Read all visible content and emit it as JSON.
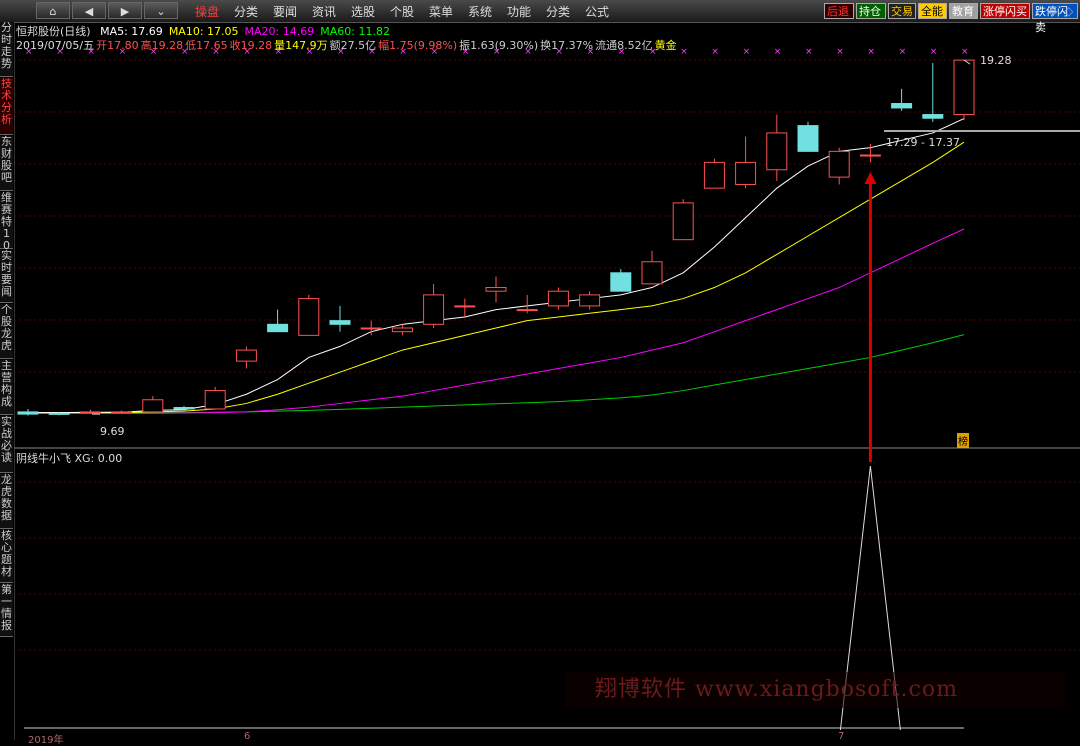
{
  "topbar": {
    "nav": [
      {
        "name": "home-icon",
        "glyph": "⌂"
      },
      {
        "name": "back-icon",
        "glyph": "◀"
      },
      {
        "name": "forward-icon",
        "glyph": "▶"
      },
      {
        "name": "expand-icon",
        "glyph": "⌄"
      }
    ],
    "menu": [
      "操盘",
      "分类",
      "要闻",
      "资讯",
      "选股",
      "个股",
      "菜单",
      "系统",
      "功能",
      "分类",
      "公式"
    ],
    "active_menu": "操盘",
    "tags": [
      {
        "label": "后退",
        "color": "#ff3030",
        "bg": "#300000"
      },
      {
        "label": "持仓",
        "color": "#ffffff",
        "bg": "#006000"
      },
      {
        "label": "交易",
        "color": "#ffcc00",
        "bg": "#202020"
      },
      {
        "label": "全能",
        "color": "#000000",
        "bg": "#ffcc00"
      },
      {
        "label": "教育",
        "color": "#ffffff",
        "bg": "#a0a0a0"
      },
      {
        "label": "涨停闪买",
        "color": "#ffffff",
        "bg": "#c00000"
      },
      {
        "label": "跌停闪卖",
        "color": "#ffffff",
        "bg": "#0050c0"
      }
    ],
    "window_controls": [
      "◇",
      "◇"
    ]
  },
  "left_tabs": [
    {
      "label": "分时走势",
      "active": false
    },
    {
      "label": "技术分析",
      "active": true
    },
    {
      "label": "东财股吧",
      "active": false
    },
    {
      "label": "维赛特10",
      "active": false
    },
    {
      "label": "实时要闻",
      "active": false
    },
    {
      "label": "个股龙虎",
      "active": false
    },
    {
      "label": "主营构成",
      "active": false
    },
    {
      "label": "实战必读",
      "active": false
    },
    {
      "label": "龙虎数据",
      "active": false
    },
    {
      "label": "核心题材",
      "active": false
    },
    {
      "label": "第一情报",
      "active": false
    }
  ],
  "header": {
    "stock": "恒邦股份(日线)",
    "ma": [
      {
        "label": "MA5: 17.69",
        "color": "#ffffff"
      },
      {
        "label": "MA10: 17.05",
        "color": "#ffff00"
      },
      {
        "label": "MA20: 14.69",
        "color": "#ff00ff"
      },
      {
        "label": "MA60: 11.82",
        "color": "#00ff00"
      }
    ],
    "date": "2019/07/05/五",
    "quote": [
      {
        "label": "开17.80",
        "color": "#ff5050"
      },
      {
        "label": "高19.28",
        "color": "#ff5050"
      },
      {
        "label": "低17.65",
        "color": "#ff5050"
      },
      {
        "label": "收19.28",
        "color": "#ff5050"
      },
      {
        "label": "量147.9万",
        "color": "#ffff00"
      },
      {
        "label": "额27.5亿",
        "color": "#cccccc"
      },
      {
        "label": "幅1.75(9.98%)",
        "color": "#ff5050"
      },
      {
        "label": "振1.63(9.30%)",
        "color": "#cccccc"
      },
      {
        "label": "换17.37%",
        "color": "#cccccc"
      },
      {
        "label": "流通8.52亿",
        "color": "#cccccc"
      },
      {
        "label": "黄金",
        "color": "#ffff00"
      }
    ]
  },
  "indicator_panel": {
    "title": "阴线牛小飞 XG: 0.00"
  },
  "annotations": {
    "high": "19.28",
    "low": "9.69",
    "price_range": "17.29 - 17.37",
    "badge": "榜"
  },
  "xaxis": {
    "left_label": "2019年",
    "mid_label": "6",
    "right_label": "7"
  },
  "watermark": "翔博软件 www.xiangbosoft.com",
  "colors": {
    "up": "#ff5050",
    "down": "#70e0e0",
    "ma5": "#ffffff",
    "ma10": "#ffff00",
    "ma20": "#ff00ff",
    "ma60": "#00cc00",
    "arrow": "#dd0000",
    "grid": "#700000"
  },
  "chart_data": {
    "type": "candlestick",
    "candles": [
      {
        "o": 9.72,
        "h": 9.8,
        "l": 9.62,
        "c": 9.66
      },
      {
        "o": 9.68,
        "h": 9.72,
        "l": 9.63,
        "c": 9.66
      },
      {
        "o": 9.7,
        "h": 9.78,
        "l": 9.68,
        "c": 9.72
      },
      {
        "o": 9.7,
        "h": 9.76,
        "l": 9.68,
        "c": 9.72
      },
      {
        "o": 9.72,
        "h": 10.15,
        "l": 9.7,
        "c": 10.05
      },
      {
        "o": 9.84,
        "h": 9.88,
        "l": 9.74,
        "c": 9.8
      },
      {
        "o": 9.8,
        "h": 10.4,
        "l": 9.78,
        "c": 10.3
      },
      {
        "o": 11.1,
        "h": 11.5,
        "l": 10.9,
        "c": 11.4
      },
      {
        "o": 12.1,
        "h": 12.5,
        "l": 11.9,
        "c": 11.9
      },
      {
        "o": 11.8,
        "h": 12.9,
        "l": 11.8,
        "c": 12.8
      },
      {
        "o": 12.2,
        "h": 12.6,
        "l": 11.9,
        "c": 12.1
      },
      {
        "o": 12.0,
        "h": 12.2,
        "l": 11.8,
        "c": 12.0
      },
      {
        "o": 11.9,
        "h": 12.1,
        "l": 11.8,
        "c": 12.0
      },
      {
        "o": 12.1,
        "h": 13.2,
        "l": 12.0,
        "c": 12.9
      },
      {
        "o": 12.6,
        "h": 12.8,
        "l": 12.3,
        "c": 12.6
      },
      {
        "o": 13.0,
        "h": 13.4,
        "l": 12.7,
        "c": 13.1
      },
      {
        "o": 12.5,
        "h": 12.9,
        "l": 12.4,
        "c": 12.5
      },
      {
        "o": 12.6,
        "h": 13.1,
        "l": 12.5,
        "c": 13.0
      },
      {
        "o": 12.6,
        "h": 13.0,
        "l": 12.5,
        "c": 12.9
      },
      {
        "o": 13.5,
        "h": 13.6,
        "l": 13.0,
        "c": 13.0
      },
      {
        "o": 13.2,
        "h": 14.1,
        "l": 13.2,
        "c": 13.8
      },
      {
        "o": 14.4,
        "h": 15.5,
        "l": 14.4,
        "c": 15.4
      },
      {
        "o": 15.8,
        "h": 16.6,
        "l": 15.8,
        "c": 16.5
      },
      {
        "o": 15.9,
        "h": 17.2,
        "l": 15.8,
        "c": 16.5
      },
      {
        "o": 16.3,
        "h": 17.8,
        "l": 16.0,
        "c": 17.3
      },
      {
        "o": 17.5,
        "h": 17.6,
        "l": 16.8,
        "c": 16.8
      },
      {
        "o": 16.1,
        "h": 16.9,
        "l": 15.9,
        "c": 16.8
      },
      {
        "o": 16.7,
        "h": 17.0,
        "l": 16.5,
        "c": 16.7
      },
      {
        "o": 18.1,
        "h": 18.5,
        "l": 17.9,
        "c": 17.98
      },
      {
        "o": 17.8,
        "h": 19.2,
        "l": 17.6,
        "c": 17.7
      },
      {
        "o": 17.8,
        "h": 19.28,
        "l": 17.65,
        "c": 19.28
      }
    ],
    "ma5": [
      9.7,
      9.7,
      9.71,
      9.71,
      9.76,
      9.78,
      9.92,
      10.2,
      10.6,
      11.2,
      11.5,
      11.9,
      12.1,
      12.2,
      12.3,
      12.5,
      12.6,
      12.7,
      12.8,
      12.9,
      13.1,
      13.5,
      14.2,
      15.0,
      15.8,
      16.4,
      16.8,
      16.9,
      17.1,
      17.3,
      17.69
    ],
    "ma10": [
      9.7,
      9.7,
      9.7,
      9.7,
      9.72,
      9.74,
      9.8,
      9.95,
      10.2,
      10.5,
      10.8,
      11.1,
      11.4,
      11.6,
      11.8,
      12.0,
      12.2,
      12.3,
      12.4,
      12.5,
      12.6,
      12.8,
      13.1,
      13.5,
      14.0,
      14.5,
      15.0,
      15.5,
      16.0,
      16.5,
      17.05
    ],
    "ma20": [
      9.68,
      9.68,
      9.68,
      9.68,
      9.68,
      9.69,
      9.7,
      9.72,
      9.78,
      9.85,
      9.95,
      10.05,
      10.15,
      10.3,
      10.45,
      10.6,
      10.75,
      10.9,
      11.05,
      11.2,
      11.4,
      11.6,
      11.9,
      12.2,
      12.5,
      12.8,
      13.1,
      13.5,
      13.9,
      14.3,
      14.69
    ],
    "ma60": [
      9.7,
      9.7,
      9.7,
      9.7,
      9.7,
      9.7,
      9.71,
      9.72,
      9.74,
      9.76,
      9.79,
      9.82,
      9.85,
      9.88,
      9.91,
      9.94,
      9.97,
      10.0,
      10.05,
      10.1,
      10.18,
      10.3,
      10.45,
      10.6,
      10.75,
      10.9,
      11.05,
      11.2,
      11.4,
      11.6,
      11.82
    ],
    "ylim": [
      9.5,
      19.5
    ],
    "signal": {
      "index": 27,
      "value": 1,
      "baseline": 0
    }
  }
}
